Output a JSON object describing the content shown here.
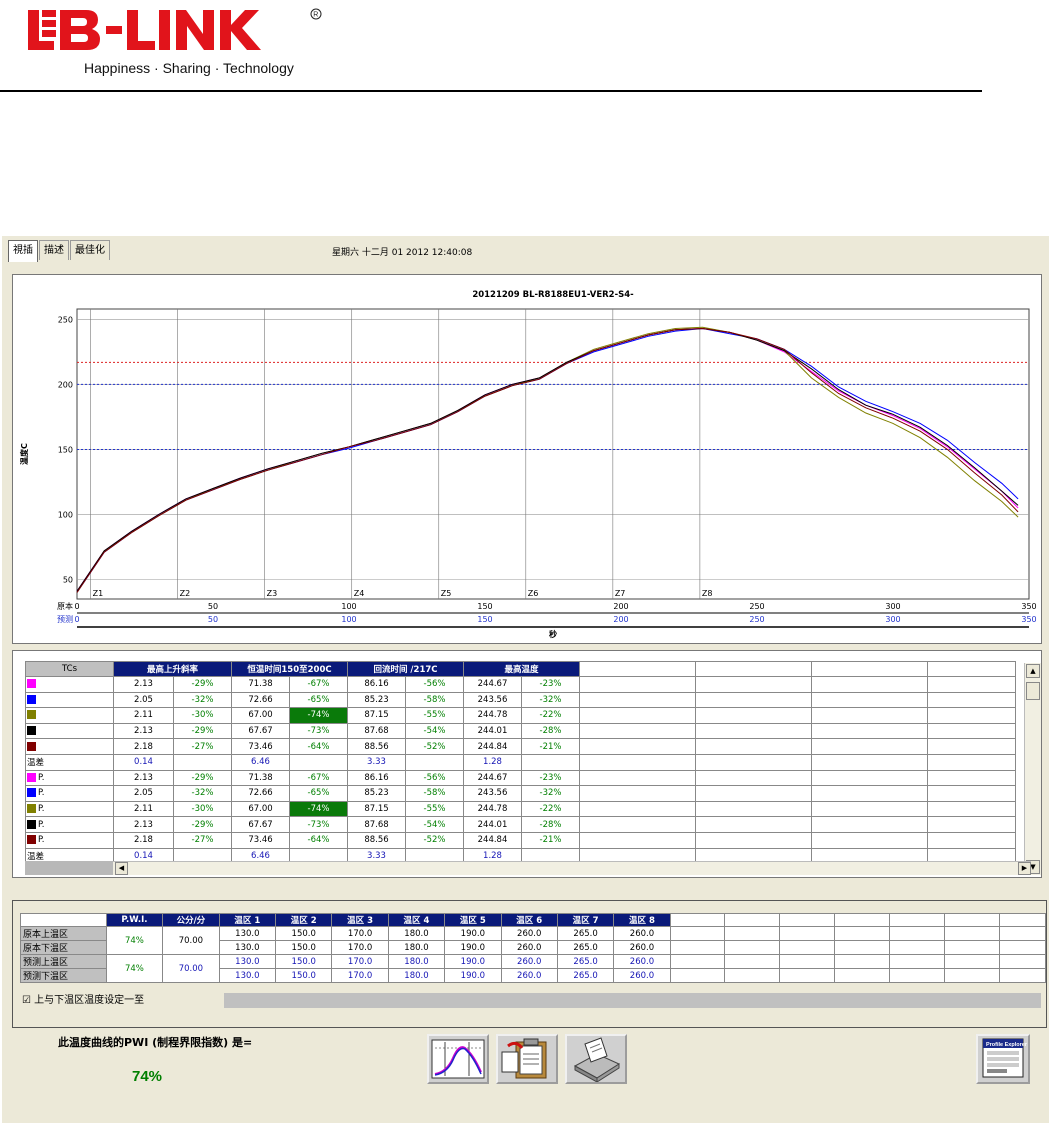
{
  "header": {
    "brand": "LB-LINK",
    "slogan": "Happiness · Sharing · Technology",
    "brand_color": "#e1141b"
  },
  "tabs": [
    {
      "label": "視插",
      "active": true
    },
    {
      "label": "描述",
      "active": false
    },
    {
      "label": "最佳化",
      "active": false
    }
  ],
  "datetime": "星期六 十二月 01 2012 12:40:08",
  "chart_data": {
    "type": "line",
    "title": "20121209 BL-R8188EU1-VER2-S4-",
    "ylabel": "温度C",
    "xlabel": "秒",
    "x_axis_labels": [
      "原本",
      "预测"
    ],
    "xlim": [
      0,
      350
    ],
    "ylim": [
      35,
      258
    ],
    "xticks": [
      0,
      50,
      100,
      150,
      200,
      250,
      300,
      350
    ],
    "yticks": [
      50,
      100,
      150,
      200,
      250
    ],
    "zones": [
      {
        "label": "Z1",
        "x": 5
      },
      {
        "label": "Z2",
        "x": 37
      },
      {
        "label": "Z3",
        "x": 69
      },
      {
        "label": "Z4",
        "x": 101
      },
      {
        "label": "Z5",
        "x": 133
      },
      {
        "label": "Z6",
        "x": 165
      },
      {
        "label": "Z7",
        "x": 197
      },
      {
        "label": "Z8",
        "x": 229
      }
    ],
    "reference_lines": [
      {
        "y": 217,
        "color": "#dd2222"
      },
      {
        "y": 200,
        "color": "#2233cc"
      },
      {
        "y": 150,
        "color": "#2233cc"
      }
    ],
    "series": [
      {
        "color": "#ff00ff",
        "points": [
          [
            0,
            41
          ],
          [
            10,
            72
          ],
          [
            20,
            87
          ],
          [
            30,
            100
          ],
          [
            40,
            112
          ],
          [
            50,
            120
          ],
          [
            60,
            128
          ],
          [
            70,
            135
          ],
          [
            80,
            141
          ],
          [
            90,
            147
          ],
          [
            100,
            152
          ],
          [
            110,
            158
          ],
          [
            120,
            164
          ],
          [
            130,
            170
          ],
          [
            140,
            180
          ],
          [
            150,
            192
          ],
          [
            160,
            200
          ],
          [
            170,
            205
          ],
          [
            180,
            217
          ],
          [
            190,
            226
          ],
          [
            200,
            232
          ],
          [
            210,
            238
          ],
          [
            220,
            242
          ],
          [
            230,
            243
          ],
          [
            240,
            240
          ],
          [
            250,
            234
          ],
          [
            260,
            225
          ],
          [
            270,
            210
          ],
          [
            280,
            195
          ],
          [
            290,
            184
          ],
          [
            300,
            176
          ],
          [
            310,
            166
          ],
          [
            320,
            152
          ],
          [
            330,
            135
          ],
          [
            340,
            118
          ],
          [
            346,
            105
          ]
        ]
      },
      {
        "color": "#0000ff",
        "points": [
          [
            0,
            40
          ],
          [
            10,
            71
          ],
          [
            20,
            86
          ],
          [
            30,
            99
          ],
          [
            40,
            111
          ],
          [
            50,
            119
          ],
          [
            60,
            127
          ],
          [
            70,
            134
          ],
          [
            80,
            140
          ],
          [
            90,
            146
          ],
          [
            100,
            151
          ],
          [
            110,
            157
          ],
          [
            120,
            163
          ],
          [
            130,
            169
          ],
          [
            140,
            179
          ],
          [
            150,
            191
          ],
          [
            160,
            199
          ],
          [
            170,
            204
          ],
          [
            180,
            216
          ],
          [
            190,
            225
          ],
          [
            200,
            231
          ],
          [
            210,
            237
          ],
          [
            220,
            241
          ],
          [
            230,
            243
          ],
          [
            240,
            239
          ],
          [
            250,
            235
          ],
          [
            260,
            227
          ],
          [
            270,
            214
          ],
          [
            280,
            198
          ],
          [
            290,
            187
          ],
          [
            300,
            179
          ],
          [
            310,
            170
          ],
          [
            320,
            157
          ],
          [
            330,
            140
          ],
          [
            340,
            124
          ],
          [
            346,
            112
          ]
        ]
      },
      {
        "color": "#808000",
        "points": [
          [
            0,
            40
          ],
          [
            10,
            72
          ],
          [
            20,
            86
          ],
          [
            30,
            99
          ],
          [
            40,
            111
          ],
          [
            50,
            120
          ],
          [
            60,
            127
          ],
          [
            70,
            134
          ],
          [
            80,
            141
          ],
          [
            90,
            147
          ],
          [
            100,
            152
          ],
          [
            110,
            158
          ],
          [
            120,
            164
          ],
          [
            130,
            170
          ],
          [
            140,
            180
          ],
          [
            150,
            191
          ],
          [
            160,
            199
          ],
          [
            170,
            205
          ],
          [
            180,
            217
          ],
          [
            190,
            227
          ],
          [
            200,
            233
          ],
          [
            210,
            239
          ],
          [
            220,
            243
          ],
          [
            230,
            244
          ],
          [
            240,
            240
          ],
          [
            250,
            234
          ],
          [
            260,
            226
          ],
          [
            270,
            205
          ],
          [
            280,
            190
          ],
          [
            290,
            178
          ],
          [
            300,
            170
          ],
          [
            310,
            159
          ],
          [
            320,
            144
          ],
          [
            330,
            126
          ],
          [
            340,
            110
          ],
          [
            346,
            98
          ]
        ]
      },
      {
        "color": "#000000",
        "points": [
          [
            0,
            41
          ],
          [
            10,
            72
          ],
          [
            20,
            87
          ],
          [
            30,
            100
          ],
          [
            40,
            112
          ],
          [
            50,
            120
          ],
          [
            60,
            128
          ],
          [
            70,
            135
          ],
          [
            80,
            141
          ],
          [
            90,
            147
          ],
          [
            100,
            152
          ],
          [
            110,
            158
          ],
          [
            120,
            164
          ],
          [
            130,
            170
          ],
          [
            140,
            180
          ],
          [
            150,
            192
          ],
          [
            160,
            200
          ],
          [
            170,
            205
          ],
          [
            180,
            217
          ],
          [
            190,
            226
          ],
          [
            200,
            232
          ],
          [
            210,
            238
          ],
          [
            220,
            242
          ],
          [
            230,
            243
          ],
          [
            240,
            240
          ],
          [
            250,
            234
          ],
          [
            260,
            226
          ],
          [
            270,
            212
          ],
          [
            280,
            196
          ],
          [
            290,
            184
          ],
          [
            300,
            177
          ],
          [
            310,
            167
          ],
          [
            320,
            153
          ],
          [
            330,
            136
          ],
          [
            340,
            118
          ],
          [
            346,
            107
          ]
        ]
      },
      {
        "color": "#800000",
        "points": [
          [
            0,
            40
          ],
          [
            10,
            71
          ],
          [
            20,
            86
          ],
          [
            30,
            99
          ],
          [
            40,
            111
          ],
          [
            50,
            119
          ],
          [
            60,
            127
          ],
          [
            70,
            134
          ],
          [
            80,
            140
          ],
          [
            90,
            146
          ],
          [
            100,
            152
          ],
          [
            110,
            157
          ],
          [
            120,
            163
          ],
          [
            130,
            169
          ],
          [
            140,
            179
          ],
          [
            150,
            191
          ],
          [
            160,
            199
          ],
          [
            170,
            204
          ],
          [
            180,
            216
          ],
          [
            190,
            226
          ],
          [
            200,
            232
          ],
          [
            210,
            238
          ],
          [
            220,
            242
          ],
          [
            230,
            243
          ],
          [
            240,
            240
          ],
          [
            250,
            235
          ],
          [
            260,
            227
          ],
          [
            270,
            209
          ],
          [
            280,
            193
          ],
          [
            290,
            182
          ],
          [
            300,
            174
          ],
          [
            310,
            164
          ],
          [
            320,
            150
          ],
          [
            330,
            132
          ],
          [
            340,
            115
          ],
          [
            346,
            102
          ]
        ]
      }
    ]
  },
  "tc_table": {
    "headers": [
      "TCs",
      "最高上升斜率",
      "恒温时间150至200C",
      "回流时间 /217C",
      "最高温度"
    ],
    "rows": [
      {
        "color": "#ff00ff",
        "label": "",
        "slope": "2.13",
        "slope_pct": "-29%",
        "soak": "71.38",
        "soak_pct": "-67%",
        "reflow": "86.16",
        "reflow_pct": "-56%",
        "peak": "244.67",
        "peak_pct": "-23%"
      },
      {
        "color": "#0000ff",
        "label": "",
        "slope": "2.05",
        "slope_pct": "-32%",
        "soak": "72.66",
        "soak_pct": "-65%",
        "reflow": "85.23",
        "reflow_pct": "-58%",
        "peak": "243.56",
        "peak_pct": "-32%"
      },
      {
        "color": "#808000",
        "label": "",
        "slope": "2.11",
        "slope_pct": "-30%",
        "soak": "67.00",
        "soak_pct": "-74%",
        "soak_hl": true,
        "reflow": "87.15",
        "reflow_pct": "-55%",
        "peak": "244.78",
        "peak_pct": "-22%"
      },
      {
        "color": "#000000",
        "label": "",
        "slope": "2.13",
        "slope_pct": "-29%",
        "soak": "67.67",
        "soak_pct": "-73%",
        "reflow": "87.68",
        "reflow_pct": "-54%",
        "peak": "244.01",
        "peak_pct": "-28%"
      },
      {
        "color": "#800000",
        "label": "",
        "slope": "2.18",
        "slope_pct": "-27%",
        "soak": "73.46",
        "soak_pct": "-64%",
        "reflow": "88.56",
        "reflow_pct": "-52%",
        "peak": "244.84",
        "peak_pct": "-21%"
      },
      {
        "diff": true,
        "label": "温差",
        "slope": "0.14",
        "soak": "6.46",
        "reflow": "3.33",
        "peak": "1.28"
      },
      {
        "color": "#ff00ff",
        "label": "P.",
        "slope": "2.13",
        "slope_pct": "-29%",
        "soak": "71.38",
        "soak_pct": "-67%",
        "reflow": "86.16",
        "reflow_pct": "-56%",
        "peak": "244.67",
        "peak_pct": "-23%"
      },
      {
        "color": "#0000ff",
        "label": "P.",
        "slope": "2.05",
        "slope_pct": "-32%",
        "soak": "72.66",
        "soak_pct": "-65%",
        "reflow": "85.23",
        "reflow_pct": "-58%",
        "peak": "243.56",
        "peak_pct": "-32%"
      },
      {
        "color": "#808000",
        "label": "P.",
        "slope": "2.11",
        "slope_pct": "-30%",
        "soak": "67.00",
        "soak_pct": "-74%",
        "soak_hl": true,
        "reflow": "87.15",
        "reflow_pct": "-55%",
        "peak": "244.78",
        "peak_pct": "-22%"
      },
      {
        "color": "#000000",
        "label": "P.",
        "slope": "2.13",
        "slope_pct": "-29%",
        "soak": "67.67",
        "soak_pct": "-73%",
        "reflow": "87.68",
        "reflow_pct": "-54%",
        "peak": "244.01",
        "peak_pct": "-28%"
      },
      {
        "color": "#800000",
        "label": "P.",
        "slope": "2.18",
        "slope_pct": "-27%",
        "soak": "73.46",
        "soak_pct": "-64%",
        "reflow": "88.56",
        "reflow_pct": "-52%",
        "peak": "244.84",
        "peak_pct": "-21%"
      },
      {
        "diff": true,
        "label": "温差",
        "slope": "0.14",
        "soak": "6.46",
        "reflow": "3.33",
        "peak": "1.28"
      }
    ]
  },
  "pwi_table": {
    "headers": [
      "P.W.I.",
      "公分/分",
      "温区 1",
      "温区 2",
      "温区 3",
      "温区 4",
      "温区 5",
      "温区 6",
      "温区 7",
      "温区 8"
    ],
    "groups": [
      {
        "pwi": "74%",
        "speed": "70.00",
        "style": "black",
        "rows": [
          {
            "label": "原本上温区",
            "zones": [
              "130.0",
              "150.0",
              "170.0",
              "180.0",
              "190.0",
              "260.0",
              "265.0",
              "260.0"
            ]
          },
          {
            "label": "原本下温区",
            "zones": [
              "130.0",
              "150.0",
              "170.0",
              "180.0",
              "190.0",
              "260.0",
              "265.0",
              "260.0"
            ]
          }
        ]
      },
      {
        "pwi": "74%",
        "speed": "70.00",
        "style": "blue",
        "rows": [
          {
            "label": "预测上温区",
            "zones": [
              "130.0",
              "150.0",
              "170.0",
              "180.0",
              "190.0",
              "260.0",
              "265.0",
              "260.0"
            ]
          },
          {
            "label": "预测下温区",
            "zones": [
              "130.0",
              "150.0",
              "170.0",
              "180.0",
              "190.0",
              "260.0",
              "265.0",
              "260.0"
            ]
          }
        ]
      }
    ],
    "checkbox_label": "上与下温区温度设定一至",
    "checkbox_checked": true
  },
  "summary": {
    "label": "此温度曲线的PWI (制程界限指数) 是=",
    "value": "74%"
  },
  "toolbar": {
    "buttons": [
      {
        "icon": "profile-chart-icon"
      },
      {
        "icon": "clipboard-icon"
      },
      {
        "icon": "printer-icon"
      }
    ],
    "profile_explorer_label": "Profile Explorer"
  }
}
